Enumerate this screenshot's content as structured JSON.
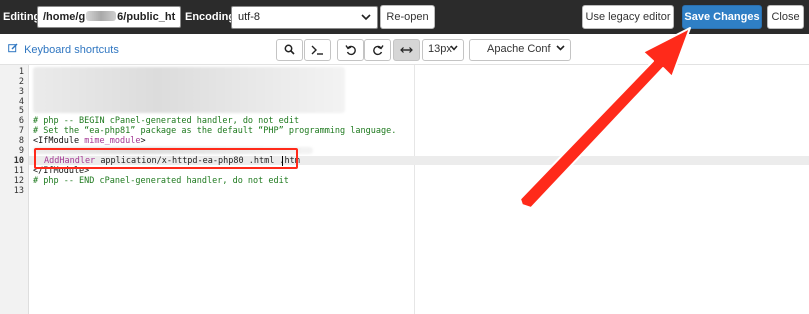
{
  "topbar": {
    "editing_label": "Editing:",
    "path_prefix": "/home/g",
    "path_suffix": "6/public_ht",
    "encoding_label": "Encoding:",
    "encoding_value": "utf-8",
    "reopen_label": "Re-open",
    "legacy_label": "Use legacy editor",
    "save_label": "Save Changes",
    "close_label": "Close"
  },
  "toolbar": {
    "keyboard_shortcuts": "Keyboard shortcuts",
    "font_size": "13px",
    "mode": "Apache Conf"
  },
  "editor": {
    "line_numbers": [
      "1",
      "2",
      "3",
      "4",
      "5",
      "6",
      "7",
      "8",
      "9",
      "10",
      "11",
      "12",
      "13"
    ],
    "active_line": "10",
    "line6": "# php -- BEGIN cPanel-generated handler, do not edit",
    "line7": "# Set the “ea-php81” package as the default “PHP” programming language.",
    "line8_open": "<IfModule",
    "line8_name": "mime_module",
    "line8_close": ">",
    "line10_directive": "AddHandler",
    "line10_args": "application/x-httpd-ea-php80 .html .htm",
    "line11": "</IfModule>",
    "line12": "# php -- END cPanel-generated handler, do not edit"
  },
  "colors": {
    "topbar_bg": "#2b2b2b",
    "primary_button": "#2f7fc5",
    "comment": "#1f7a1f",
    "keyword": "#a43a95",
    "annotation_red": "#ff2a1a"
  },
  "icons": [
    "search-icon",
    "terminal-icon",
    "undo-icon",
    "redo-icon",
    "wrap-toggle-icon",
    "edit-icon",
    "chevron-down-icon"
  ]
}
